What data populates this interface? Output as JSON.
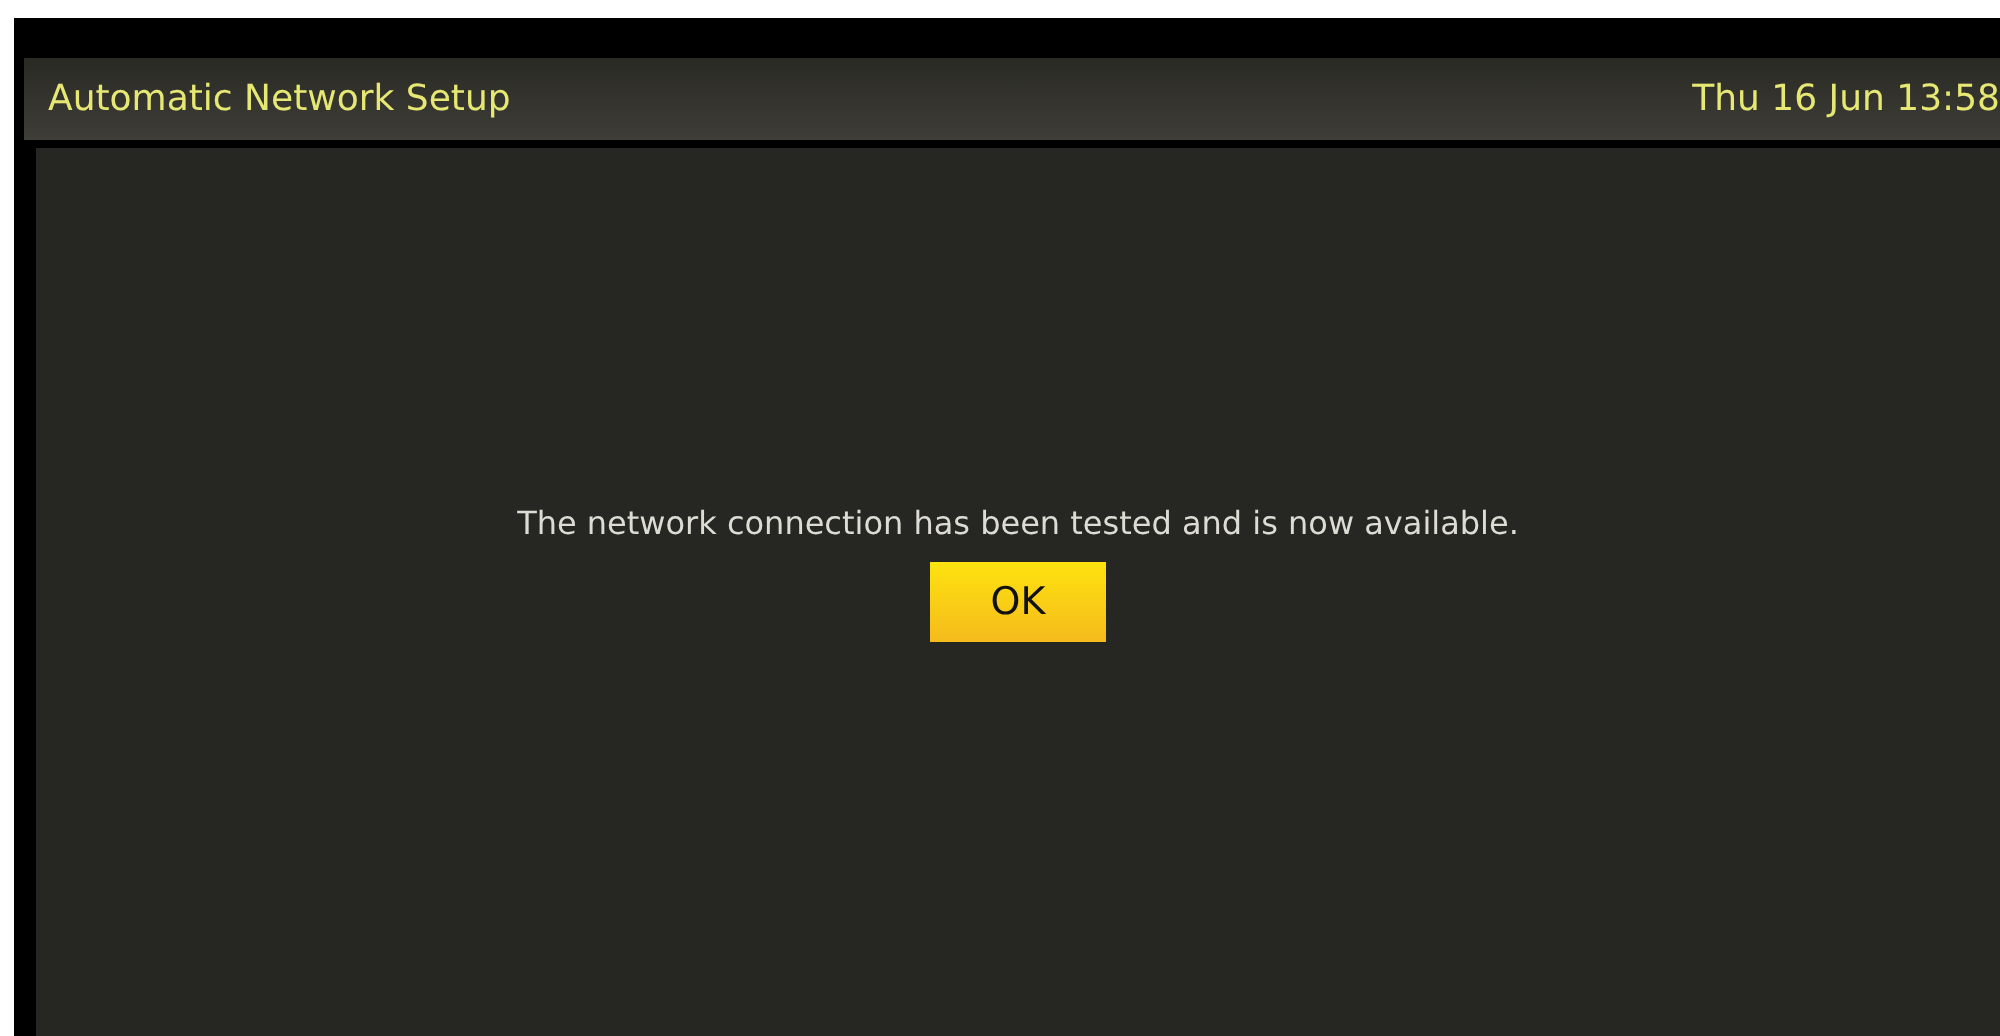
{
  "header": {
    "title": "Automatic Network Setup",
    "datetime": "Thu 16 Jun 13:58"
  },
  "dialog": {
    "message": "The network connection has been tested and is now available.",
    "buttons": [
      "OK"
    ]
  }
}
